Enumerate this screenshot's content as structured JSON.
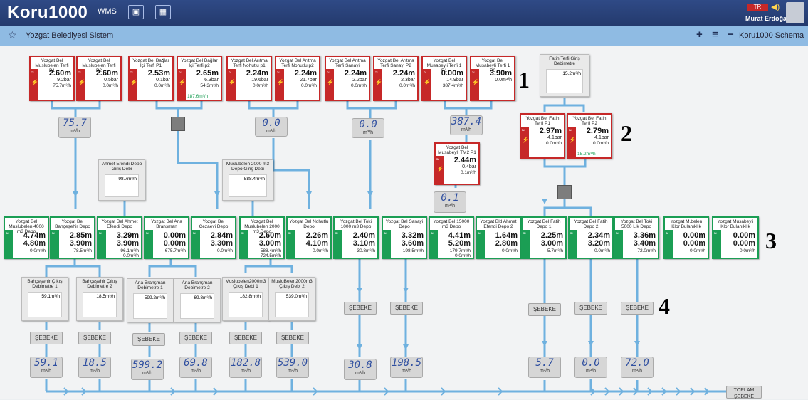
{
  "header": {
    "logo": "Koru1000",
    "product": "WMS",
    "lang": "TR",
    "user": "Murat Erdoğan",
    "page_title": "Yozgat Belediyesi Sistem",
    "schema": "Koru1000 Schema"
  },
  "icons": {
    "image": "image-icon",
    "grid": "grid-icon",
    "star": "star-icon",
    "plus": "plus-icon",
    "menu": "hamburger-icon",
    "minus": "minus-icon",
    "speaker": "speaker-icon"
  },
  "colors": {
    "header": "#243a6d",
    "toolbar": "#8fbbe3",
    "alarm": "#c62828",
    "ok": "#1b9e54",
    "pipe": "#6fb1df"
  },
  "pumps_row1": [
    {
      "title": "Yozgat Bel Muslubelen Terfi P1",
      "v1": "2.60m",
      "v2": "9.2bar",
      "v3": "75.7m³/h"
    },
    {
      "title": "Yozgat Bel Muslubelen Terfi P2",
      "v1": "2.60m",
      "v2": "0.5bar",
      "v3": "0.0m³/h"
    },
    {
      "title": "Yozgat Bel Bağlar İçi Terfi P1",
      "v1": "2.53m",
      "v2": "0.1bar",
      "v3": "0.0m³/h"
    },
    {
      "title": "Yozgat Bel Bağlar İçi Terfi p2",
      "v1": "2.65m",
      "v2": "6.3bar",
      "v3": "54.3m³/h",
      "v4": "187.6m³/h"
    },
    {
      "title": "Yozgat Bel Arıtma Terfi Nohutlu p1",
      "v1": "2.24m",
      "v2": "19.6bar",
      "v3": "0.0m³/h"
    },
    {
      "title": "Yozgat Bel Arıtma Terfi Nohutlu p2",
      "v1": "2.24m",
      "v2": "21.7bar",
      "v3": "0.0m³/h"
    },
    {
      "title": "Yozgat Bel Arıtma Terfi Sanayi",
      "v1": "2.24m",
      "v2": "2.2bar",
      "v3": "0.0m³/h"
    },
    {
      "title": "Yozgat Bel Arıtma Terfi Sanayi P2",
      "v1": "2.24m",
      "v2": "2.3bar",
      "v3": "0.0m³/h"
    },
    {
      "title": "Yozgat Bel Musabeyli Terfi 1 P1",
      "v1": "0.00m",
      "v2": "14.9bar",
      "v3": "387.4m³/h"
    },
    {
      "title": "Yozgat Bel Musabeyli Terfi 1 P6",
      "v1": "3.90m",
      "v2": "0.0m³/h",
      "v3": ""
    }
  ],
  "fatih_giris": {
    "title": "Fatih Terfi Giriş Debimetre",
    "value": "15.2m³/h"
  },
  "fatih_pumps": [
    {
      "title": "Yozgat Bel Fatih Terfi P1",
      "v1": "2.97m",
      "v2": "4.1bar",
      "v3": "0.0m³/h"
    },
    {
      "title": "Yozgat Bel Fatih Terfi P2",
      "v1": "2.79m",
      "v2": "4.1bar",
      "v3": "0.0m³/h",
      "v4": "15.2m³/h"
    }
  ],
  "tm2": {
    "title": "Yozgat Bel Musabeyli TM2 P1",
    "v1": "2.44m",
    "v2": "0.4bar",
    "v3": "0.1m³/h"
  },
  "flows_top": [
    {
      "num": "75.7",
      "unit": "m³/h"
    },
    {
      "num": "0.0",
      "unit": "m³/h"
    },
    {
      "num": "0.0",
      "unit": "m³/h"
    },
    {
      "num": "387.4",
      "unit": "m³/h"
    },
    {
      "num": "0.1",
      "unit": "m³/h"
    }
  ],
  "giris": [
    {
      "title": "Ahmet Efendi Depo Giriş Debi",
      "value": "98.7m³/h"
    },
    {
      "title": "Muslubelen 2000 m3 Depo Giriş Debi",
      "value": "588.4m³/h"
    }
  ],
  "depos": [
    {
      "title": "Yozgat Bel Muslubelen 4000 m3 Depo",
      "v1": "4.74m",
      "v2": "4.80m",
      "v3": "0.0m³/h"
    },
    {
      "title": "Yozgat Bel Bahçeşehir Depo",
      "v1": "2.85m",
      "v2": "3.90m",
      "v3": "78.5m³/h"
    },
    {
      "title": "Yozgat Bel Ahmet Efendi Depo",
      "v1": "3.29m",
      "v2": "3.90m",
      "v3": "96.1m³/h",
      "v4": "0.0m³/h"
    },
    {
      "title": "Yozgat Bel Ana Branşman",
      "v1": "0.00m",
      "v2": "0.00m",
      "v3": "675.7m³/h"
    },
    {
      "title": "Yozgat Bel Cezaevi Depo",
      "v1": "2.84m",
      "v2": "3.30m",
      "v3": "0.0m³/h"
    },
    {
      "title": "Yozgat Bel Muslubelen 2000 m3 Depo",
      "v1": "2.60m",
      "v2": "3.00m",
      "v3": "588.4m³/h",
      "v4": "724.5m³/h"
    },
    {
      "title": "Yozgat Bel Nohutlu Depo",
      "v1": "2.26m",
      "v2": "4.10m",
      "v3": "0.0m³/h"
    },
    {
      "title": "Yozgat Bel Toki 1000 m3 Depo",
      "v1": "2.40m",
      "v2": "3.10m",
      "v3": "30.8m³/h"
    },
    {
      "title": "Yozgat Bel Sanayi Depo",
      "v1": "3.32m",
      "v2": "3.60m",
      "v3": "198.5m³/h"
    },
    {
      "title": "Yozgat Bel 15000 m3 Depo",
      "v1": "4.41m",
      "v2": "5.20m",
      "v3": "179.7m³/h",
      "v4": "0.0m³/h"
    },
    {
      "title": "Yozgat Bld Ahmet Efendi Depo 2",
      "v1": "1.64m",
      "v2": "2.80m",
      "v3": "0.0m³/h"
    },
    {
      "title": "Yozgat Bel Fatih Depo 1",
      "v1": "2.25m",
      "v2": "3.00m",
      "v3": "5.7m³/h"
    },
    {
      "title": "Yozgat Bel Fatih Depo 2",
      "v1": "2.34m",
      "v2": "3.20m",
      "v3": "0.0m³/h"
    },
    {
      "title": "Yozgat Bel Toki 5000 Lik Depo",
      "v1": "3.36m",
      "v2": "3.40m",
      "v3": "72.0m³/h"
    },
    {
      "title": "Yozgat M.belen Klor Bulanıklık",
      "v1": "0.00m",
      "v2": "0.00m",
      "v3": "0.0m³/h"
    },
    {
      "title": "Yozgat Musabeyli Klor Bulanıklık",
      "v1": "0.00m",
      "v2": "0.00m",
      "v3": "0.0m³/h"
    }
  ],
  "outlets": [
    {
      "title": "Bahçeşehir Çıkış Debimetre 1",
      "value": "59.1m³/h"
    },
    {
      "title": "Bahçeşehir Çıkış Debimetre 2",
      "value": "18.5m³/h"
    },
    {
      "title": "Ana Branşman Debimetre 1",
      "value": "599.2m³/h"
    },
    {
      "title": "Ana Branşman Debimetre 2",
      "value": "69.8m³/h"
    },
    {
      "title": "Muslubelen2000m3 Çıkış Debi 1",
      "value": "182.8m³/h"
    },
    {
      "title": "MusluBelen2000m3 Çıkış Debi 2",
      "value": "539.0m³/h"
    }
  ],
  "sebeke_label": "ŞEBEKE",
  "flows_bottom": [
    {
      "num": "59.1",
      "unit": "m³/h"
    },
    {
      "num": "18.5",
      "unit": "m³/h"
    },
    {
      "num": "599.2",
      "unit": "m³/h"
    },
    {
      "num": "69.8",
      "unit": "m³/h"
    },
    {
      "num": "182.8",
      "unit": "m³/h"
    },
    {
      "num": "539.0",
      "unit": "m³/h"
    },
    {
      "num": "30.8",
      "unit": "m³/h"
    },
    {
      "num": "198.5",
      "unit": "m³/h"
    },
    {
      "num": "5.7",
      "unit": "m³/h"
    },
    {
      "num": "0.0",
      "unit": "m³/h"
    },
    {
      "num": "72.0",
      "unit": "m³/h"
    }
  ],
  "toplam": "TOPLAM ŞEBEKE",
  "annotations": [
    "1",
    "2",
    "3",
    "4"
  ]
}
